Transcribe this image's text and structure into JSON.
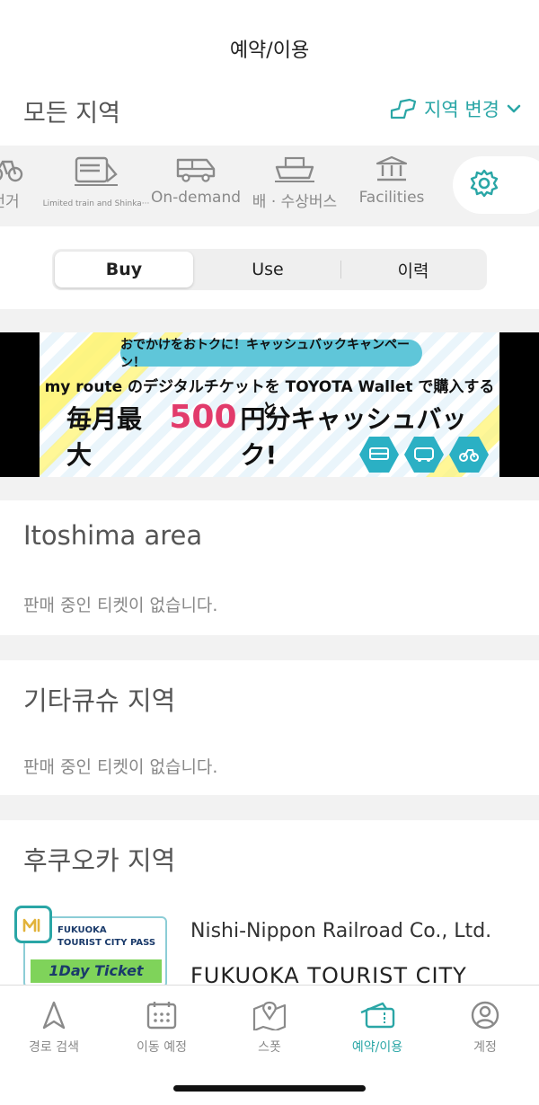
{
  "header": {
    "title": "예약/이용"
  },
  "region": {
    "title": "모든 지역",
    "change_label": "지역 변경"
  },
  "categories": [
    {
      "label": "전거",
      "icon": "bicycle-icon"
    },
    {
      "label": "Limited train and Shinka···",
      "icon": "train-icon"
    },
    {
      "label": "On-demand",
      "icon": "van-icon"
    },
    {
      "label": "배 · 수상버스",
      "icon": "ship-icon"
    },
    {
      "label": "Facilities",
      "icon": "building-icon"
    }
  ],
  "segments": [
    {
      "label": "Buy",
      "active": true
    },
    {
      "label": "Use",
      "active": false
    },
    {
      "label": "이력",
      "active": false
    }
  ],
  "banner": {
    "line1": "おでかけをおトクに！キャッシュバックキャンペーン！",
    "line2": "my route のデジタルチケットを TOYOTA Wallet で購入すると",
    "line3_a": "毎月最大",
    "line3_num": "500",
    "line3_b": "円分キャッシュバック!"
  },
  "sections": [
    {
      "title": "Itoshima area",
      "message": "판매 중인 티켓이 없습니다."
    },
    {
      "title": "기타큐슈 지역",
      "message": "판매 중인 티켓이 없습니다."
    },
    {
      "title": "후쿠오카 지역"
    }
  ],
  "ticket": {
    "thumb_line1": "FUKUOKA",
    "thumb_line2": "TOURIST CITY PASS",
    "thumb_line3": "1Day Ticket",
    "company": "Nishi-Nippon Railroad Co., Ltd.",
    "name": "FUKUOKA TOURIST CITY"
  },
  "tabs": [
    {
      "label": "경로 검색",
      "icon": "navigation-arrow-icon",
      "active": false
    },
    {
      "label": "이동 예정",
      "icon": "calendar-icon",
      "active": false
    },
    {
      "label": "스폿",
      "icon": "map-pin-icon",
      "active": false
    },
    {
      "label": "예약/이용",
      "icon": "ticket-icon",
      "active": true
    },
    {
      "label": "계정",
      "icon": "account-icon",
      "active": false
    }
  ],
  "colors": {
    "accent": "#2aa6a6",
    "banner_pink": "#e23b6b",
    "banner_cyan": "#5fc6d9"
  }
}
